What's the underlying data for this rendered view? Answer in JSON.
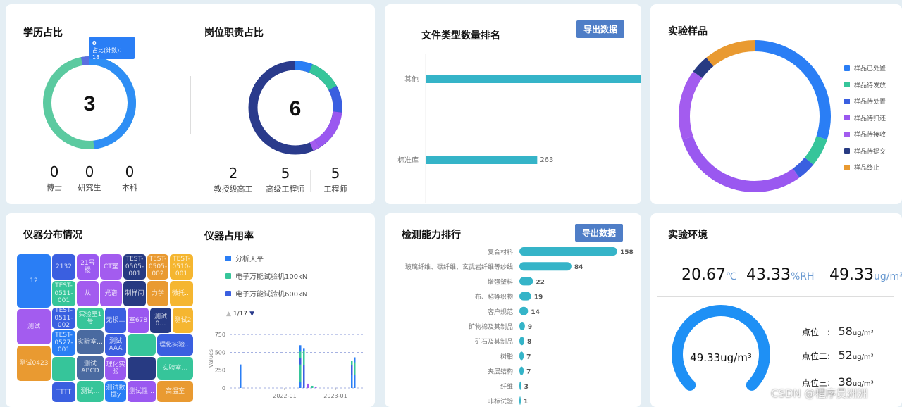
{
  "education": {
    "title": "学历占比",
    "center_value": "3",
    "tooltip_name": "0",
    "tooltip_text": "占比(计数)：18",
    "stats": [
      {
        "value": "0",
        "label": "博士"
      },
      {
        "value": "0",
        "label": "研究生"
      },
      {
        "value": "0",
        "label": "本科"
      }
    ],
    "colors": [
      "#2e8ef5",
      "#5bcaa0",
      "#5b6fe0"
    ]
  },
  "position": {
    "title": "岗位职责占比",
    "center_value": "6",
    "stats": [
      {
        "value": "2",
        "label": "教授级高工"
      },
      {
        "value": "5",
        "label": "高级工程师"
      },
      {
        "value": "5",
        "label": "工程师"
      }
    ]
  },
  "file_types": {
    "title": "文件类型数量排名",
    "export_label": "导出数据",
    "chart_data": {
      "type": "bar",
      "orientation": "horizontal",
      "categories": [
        "其他",
        "标准库"
      ],
      "values": [
        520,
        263
      ],
      "value_labels": [
        "",
        "263"
      ],
      "x_ticks": [
        "0",
        "100",
        "200",
        "300",
        "400",
        "500"
      ],
      "xlim": [
        0,
        500
      ],
      "color": "#35b4c8"
    }
  },
  "samples": {
    "title": "实验样品",
    "chart_data": {
      "type": "pie",
      "style": "donut",
      "legend_position": "right",
      "labels": [
        "样品已处置",
        "样品待发放",
        "样品待处置",
        "样品待归还",
        "样品待接收",
        "样品待提交",
        "样品终止"
      ],
      "values": [
        30,
        6,
        4,
        30,
        15,
        4,
        11
      ],
      "colors": [
        "#2a7ef5",
        "#36c59a",
        "#3a5fe0",
        "#9a58f0",
        "#a35cef",
        "#273a82",
        "#e99a31"
      ]
    }
  },
  "instruments": {
    "title": "仪器分布情况",
    "treemap": [
      {
        "label": "12",
        "color": "#2a7ef5"
      },
      {
        "label": "2132",
        "color": "#3a5fe0"
      },
      {
        "label": "21号楼",
        "color": "#9a58f0"
      },
      {
        "label": "CT室",
        "color": "#a35cef"
      },
      {
        "label": "TEST-0505-001",
        "color": "#273a82"
      },
      {
        "label": "TEST-0505-002",
        "color": "#e99a31"
      },
      {
        "label": "TEST-0510-001",
        "color": "#f5b630"
      },
      {
        "label": "TEST-0511-001",
        "color": "#36c59a"
      },
      {
        "label": "从",
        "color": "#a35cef"
      },
      {
        "label": "光谱",
        "color": "#a35cef"
      },
      {
        "label": "制样间",
        "color": "#273a82"
      },
      {
        "label": "力学",
        "color": "#e99a31"
      },
      {
        "label": "微托…",
        "color": "#f5b630"
      },
      {
        "label": "测试",
        "color": "#a35cef"
      },
      {
        "label": "TEST-0511-002",
        "color": "#3a5fe0"
      },
      {
        "label": "实验室1号",
        "color": "#36c59a"
      },
      {
        "label": "无损…",
        "color": "#3a5fe0"
      },
      {
        "label": "室678",
        "color": "#9a58f0"
      },
      {
        "label": "测试0…",
        "color": "#273a82"
      },
      {
        "label": "测试2",
        "color": "#f5b630"
      },
      {
        "label": "测试0423",
        "color": "#e99a31"
      },
      {
        "label": "TEST-0527-001",
        "color": "#2a7ef5"
      },
      {
        "label": "实验室…",
        "color": "#4a6aa0"
      },
      {
        "label": "测试AAA",
        "color": "#3a5fe0"
      },
      {
        "label": "",
        "color": "#36c59a"
      },
      {
        "label": "理化实验…",
        "color": "#3a5fe0"
      },
      {
        "label": "测试ABCD",
        "color": "#4a6aa0"
      },
      {
        "label": "理化实验",
        "color": "#9a58f0"
      },
      {
        "label": "",
        "color": "#273a82"
      },
      {
        "label": "实验室…",
        "color": "#36c59a"
      },
      {
        "label": "",
        "color": "#36c59a"
      },
      {
        "label": "TTTT",
        "color": "#3a5fe0"
      },
      {
        "label": "测试…",
        "color": "#36c59a"
      },
      {
        "label": "测试数据y",
        "color": "#2a7ef5"
      },
      {
        "label": "测试性…",
        "color": "#9a58f0"
      },
      {
        "label": "高温室",
        "color": "#e99a31"
      }
    ]
  },
  "usage": {
    "title": "仪器占用率",
    "legend": [
      {
        "label": "分析天平",
        "color": "#2a7ef5"
      },
      {
        "label": "电子万能试验机100kN",
        "color": "#36c59a"
      },
      {
        "label": "电子万能试验机600kN",
        "color": "#3a5fe0"
      }
    ],
    "pager": "1/17",
    "y_label": "Values",
    "chart_data": {
      "type": "bar",
      "y_ticks": [
        "0",
        "250",
        "500",
        "750"
      ],
      "ylim": [
        0,
        850
      ],
      "x_ticks": [
        "2022-01",
        "2023-01"
      ]
    }
  },
  "capability": {
    "title": "检测能力排行",
    "export_label": "导出数据",
    "chart_data": {
      "type": "bar",
      "orientation": "horizontal",
      "categories": [
        "复合材料",
        "玻璃纤维、碳纤维、玄武岩纤维等纱线",
        "增强塑料",
        "布、毡等织物",
        "客户规范",
        "矿物棉及其制品",
        "矿石及其制品",
        "树脂",
        "夹层结构",
        "纤维",
        "非标试验"
      ],
      "values": [
        158,
        84,
        22,
        19,
        14,
        9,
        8,
        7,
        7,
        3,
        1
      ],
      "color": "#35b4c8"
    }
  },
  "environment": {
    "title": "实验环境",
    "temperature": "20.67",
    "temperature_unit": "℃",
    "humidity": "43.33",
    "humidity_unit": "%RH",
    "concentration": "49.33",
    "concentration_unit": "ug/m³",
    "gauge_text": "49.33ug/m³",
    "gauge_fraction": 0.75,
    "points": [
      {
        "label": "点位一:",
        "value": "58",
        "unit": "ug/m³"
      },
      {
        "label": "点位二:",
        "value": "52",
        "unit": "ug/m³"
      },
      {
        "label": "点位三:",
        "value": "38",
        "unit": "ug/m³"
      }
    ]
  },
  "watermark": "CSDN @程序员洲洲"
}
